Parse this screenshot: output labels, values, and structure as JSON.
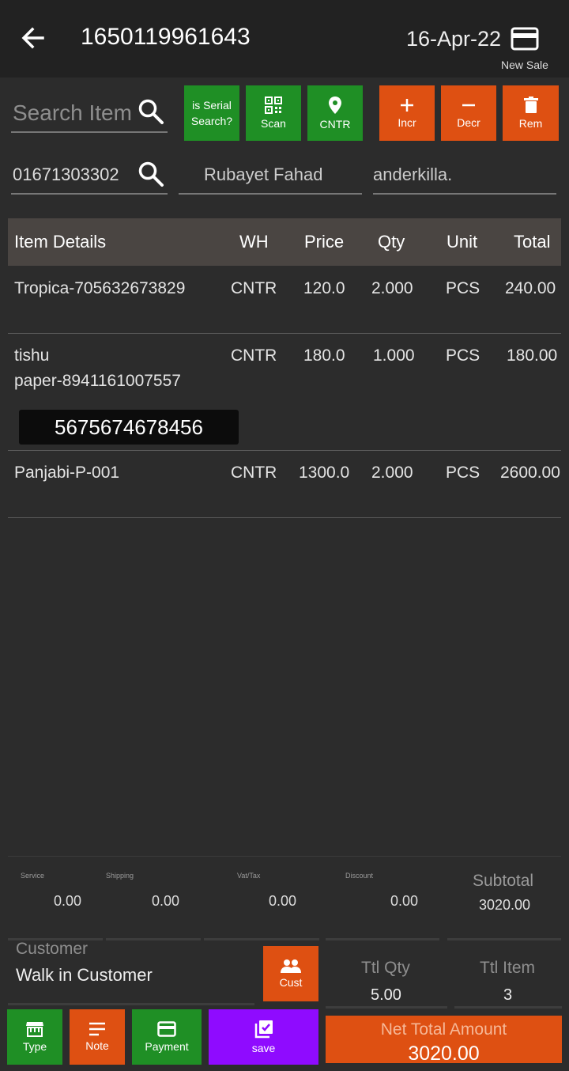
{
  "header": {
    "invoice_no": "1650119961643",
    "date": "16-Apr-22",
    "new_sale_label": "New Sale",
    "back_icon": "arrow-left-icon",
    "card_icon": "credit-card-icon"
  },
  "search": {
    "placeholder": "Search Item",
    "value": ""
  },
  "buttons": {
    "serial": "is Serial Search?",
    "scan": "Scan",
    "cntr": "CNTR",
    "incr": "Incr",
    "decr": "Decr",
    "rem": "Rem",
    "cust": "Cust",
    "type": "Type",
    "note": "Note",
    "payment": "Payment",
    "save": "save"
  },
  "customer_row": {
    "phone": "01671303302",
    "name": "Rubayet Fahad",
    "address": "anderkilla."
  },
  "table": {
    "headers": [
      "Item Details",
      "WH",
      "Price",
      "Qty",
      "Unit",
      "Total"
    ],
    "rows": [
      {
        "item": "Tropica-705632673829",
        "item_line2": "",
        "wh": "CNTR",
        "price": "120.0",
        "qty": "2.000",
        "unit": "PCS",
        "total": "240.00",
        "serial": ""
      },
      {
        "item": "tishu",
        "item_line2": "paper-8941161007557",
        "wh": "CNTR",
        "price": "180.0",
        "qty": "1.000",
        "unit": "PCS",
        "total": "180.00",
        "serial": "5675674678456"
      },
      {
        "item": "Panjabi-P-001",
        "item_line2": "",
        "wh": "CNTR",
        "price": "1300.0",
        "qty": "2.000",
        "unit": "PCS",
        "total": "2600.00",
        "serial": ""
      }
    ]
  },
  "charges": {
    "service_label": "Service",
    "service": "0.00",
    "shipping_label": "Shipping",
    "shipping": "0.00",
    "vat_label": "Vat/Tax",
    "vat": "0.00",
    "discount_label": "Discount",
    "discount": "0.00",
    "subtotal_label": "Subtotal",
    "subtotal": "3020.00"
  },
  "customer": {
    "label": "Customer",
    "value": "Walk in Customer"
  },
  "totals": {
    "ttl_qty_label": "Ttl Qty",
    "ttl_qty": "5.00",
    "ttl_item_label": "Ttl Item",
    "ttl_item": "3",
    "net_label": "Net Total Amount",
    "net_total": "3020.00"
  },
  "colors": {
    "green": "#1f8f25",
    "orange": "#de5012",
    "purple": "#8f0bff",
    "background": "#2c2c2c"
  }
}
